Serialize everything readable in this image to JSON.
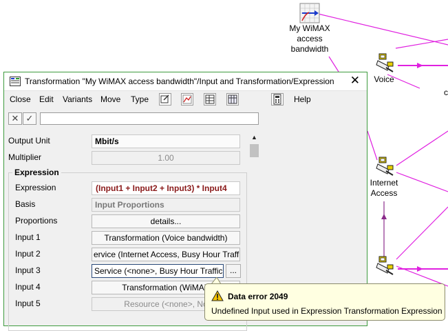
{
  "diagram": {
    "nodes": [
      {
        "id": "bandwidth",
        "label_lines": [
          "My WiMAX",
          "access",
          "bandwidth"
        ],
        "icon": "chart-icon"
      },
      {
        "id": "voice",
        "label_lines": [
          "Voice"
        ],
        "icon": "plug-icon"
      },
      {
        "id": "internet",
        "label_lines": [
          "Internet",
          "Access"
        ],
        "icon": "plug-icon"
      },
      {
        "id": "third",
        "label_lines": [],
        "icon": "plug-icon"
      }
    ],
    "partial_label": "c",
    "line_color": "#e020e0",
    "arrow_color": "#8a2a8a"
  },
  "window": {
    "title": "Transformation \"My WiMAX access bandwidth\"/Input and Transformation/Expression",
    "close_glyph": "✕",
    "menu": [
      "Close",
      "Edit",
      "Variants",
      "Move",
      "Type"
    ],
    "menu_help": "Help",
    "toolbar_icons": [
      "properties-icon",
      "chart-icon",
      "table-icon",
      "grid-icon",
      "calculator-icon"
    ],
    "edit_cancel": "✕",
    "edit_accept": "✓",
    "edit_value": ""
  },
  "form": {
    "output_unit_label": "Output Unit",
    "output_unit_value": "Mbit/s",
    "multiplier_label": "Multiplier",
    "multiplier_value": "1.00",
    "group_title": "Expression",
    "rows": [
      {
        "label": "Expression",
        "value": "(Input1 + Input2 + Input3)  * Input4",
        "style": "expr"
      },
      {
        "label": "Basis",
        "value": "Input Proportions",
        "style": "grey"
      },
      {
        "label": "Proportions",
        "value": "details...",
        "style": "btn"
      },
      {
        "label": "Input 1",
        "value": "Transformation (Voice bandwidth)",
        "style": "btn"
      },
      {
        "label": "Input 2",
        "value": "ervice (Internet Access, Busy Hour Traffic",
        "style": "btn"
      },
      {
        "label": "Input 3",
        "value": "Service (<none>, Busy Hour Traffic)",
        "style": "focus"
      },
      {
        "label": "Input 4",
        "value": "Transformation (WiMAX",
        "style": "btn"
      },
      {
        "label": "Input 5",
        "value": "Resource (<none>, No",
        "style": "disabled"
      }
    ],
    "ellipsis_label": "..."
  },
  "tooltip": {
    "title": "Data error 2049",
    "message": "Undefined Input used in Expression Transformation Expression",
    "icon": "warning-icon"
  }
}
